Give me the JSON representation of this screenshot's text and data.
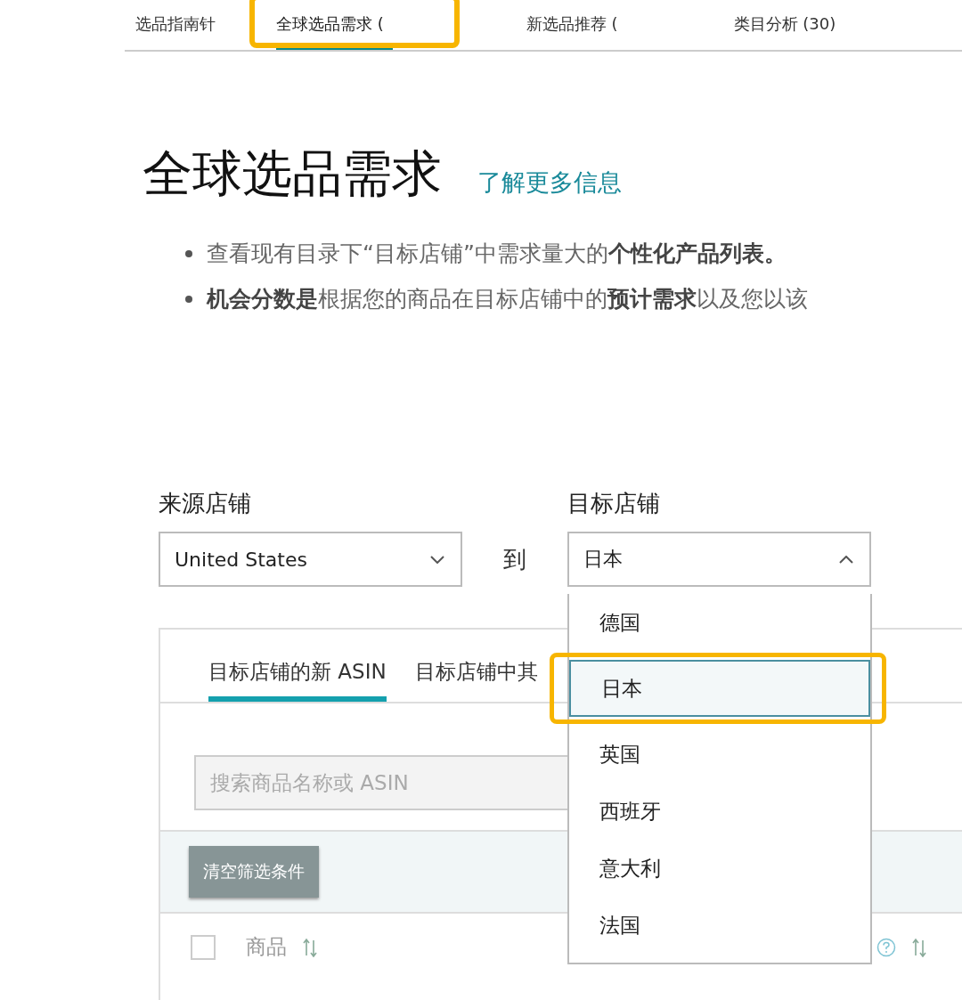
{
  "tabs": [
    {
      "label": "选品指南针",
      "selected": false
    },
    {
      "label": "全球选品需求 (",
      "selected": true
    },
    {
      "label": "新选品推荐 (",
      "selected": false
    },
    {
      "label": "类目分析 (30)",
      "selected": false
    }
  ],
  "page": {
    "title": "全球选品需求",
    "link": "了解更多信息",
    "bullets": [
      "查看现有目录下“目标店铺”中需求量大的**个性化产品列表。**",
      "**机会分数是**根据您的商品在目标店铺中的**预计需求**以及您以该"
    ]
  },
  "source_store": {
    "label": "来源店铺",
    "value": "United States",
    "expanded": false
  },
  "connector": "到",
  "target_store": {
    "label": "目标店铺",
    "value": "日本",
    "expanded": true,
    "options": [
      {
        "label": "德国",
        "selected": false
      },
      {
        "label": "日本",
        "selected": true
      },
      {
        "label": "英国",
        "selected": false
      },
      {
        "label": "西班牙",
        "selected": false
      },
      {
        "label": "意大利",
        "selected": false
      },
      {
        "label": "法国",
        "selected": false
      }
    ]
  },
  "panel": {
    "tabs": [
      {
        "label": "目标店铺的新 ASIN",
        "selected": true
      },
      {
        "label": "目标店铺中其",
        "selected": false
      }
    ],
    "search": {
      "placeholder": "搜索商品名称或 ASIN"
    },
    "clear_button": "清空筛选条件",
    "table": {
      "columns": [
        {
          "label": "商品"
        }
      ],
      "select_all": {
        "checked": false
      }
    }
  }
}
